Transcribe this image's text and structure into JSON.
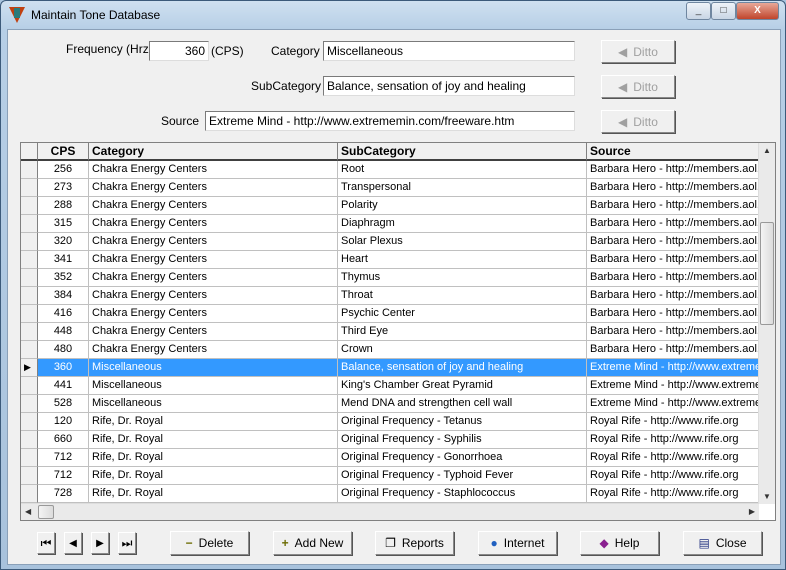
{
  "window": {
    "title": "Maintain Tone Database",
    "minimize": "_",
    "maximize": "□",
    "close": "X"
  },
  "form": {
    "frequency_label": "Frequency (Hrz)",
    "frequency_value": "360",
    "cps_label": "(CPS)",
    "category_label": "Category",
    "category_value": "Miscellaneous",
    "subcategory_label": "SubCategory",
    "subcategory_value": "Balance, sensation of joy and healing",
    "source_label": "Source",
    "source_value": "Extreme Mind - http://www.extrememin.com/freeware.htm",
    "ditto_label": "Ditto"
  },
  "grid": {
    "columns": [
      "CPS",
      "Category",
      "SubCategory",
      "Source"
    ],
    "selected_index": 11,
    "rows": [
      [
        "256",
        "Chakra Energy Centers",
        "Root",
        "Barbara Hero - http://members.aol.com"
      ],
      [
        "273",
        "Chakra Energy Centers",
        "Transpersonal",
        "Barbara Hero - http://members.aol.com"
      ],
      [
        "288",
        "Chakra Energy Centers",
        "Polarity",
        "Barbara Hero - http://members.aol.com"
      ],
      [
        "315",
        "Chakra Energy Centers",
        "Diaphragm",
        "Barbara Hero - http://members.aol.com"
      ],
      [
        "320",
        "Chakra Energy Centers",
        "Solar Plexus",
        "Barbara Hero - http://members.aol.com"
      ],
      [
        "341",
        "Chakra Energy Centers",
        "Heart",
        "Barbara Hero - http://members.aol.com"
      ],
      [
        "352",
        "Chakra Energy Centers",
        "Thymus",
        "Barbara Hero - http://members.aol.com"
      ],
      [
        "384",
        "Chakra Energy Centers",
        "Throat",
        "Barbara Hero - http://members.aol.com"
      ],
      [
        "416",
        "Chakra Energy Centers",
        "Psychic Center",
        "Barbara Hero - http://members.aol.com"
      ],
      [
        "448",
        "Chakra Energy Centers",
        "Third Eye",
        "Barbara Hero - http://members.aol.com"
      ],
      [
        "480",
        "Chakra Energy Centers",
        "Crown",
        "Barbara Hero - http://members.aol.com"
      ],
      [
        "360",
        "Miscellaneous",
        "Balance, sensation of joy and healing",
        "Extreme Mind - http://www.extrememin.com"
      ],
      [
        "441",
        "Miscellaneous",
        "King's Chamber Great Pyramid",
        "Extreme Mind - http://www.extrememin.com"
      ],
      [
        "528",
        "Miscellaneous",
        "Mend DNA and strengthen cell wall",
        "Extreme Mind - http://www.extrememin.com"
      ],
      [
        "120",
        "Rife, Dr. Royal",
        "Original Frequency - Tetanus",
        "Royal Rife - http://www.rife.org"
      ],
      [
        "660",
        "Rife, Dr. Royal",
        "Original Frequency - Syphilis",
        "Royal Rife - http://www.rife.org"
      ],
      [
        "712",
        "Rife, Dr. Royal",
        "Original Frequency - Gonorrhoea",
        "Royal Rife - http://www.rife.org"
      ],
      [
        "712",
        "Rife, Dr. Royal",
        "Original Frequency - Typhoid Fever",
        "Royal Rife - http://www.rife.org"
      ],
      [
        "728",
        "Rife, Dr. Royal",
        "Original Frequency - Staphlococcus",
        "Royal Rife - http://www.rife.org"
      ]
    ]
  },
  "nav": {
    "first": "⏮",
    "prev": "◀",
    "next": "▶",
    "last": "⏭"
  },
  "buttons": {
    "delete": "Delete",
    "add_new": "Add New",
    "reports": "Reports",
    "internet": "Internet",
    "help": "Help",
    "close": "Close"
  },
  "colors": {
    "selection": "#3399ff"
  }
}
